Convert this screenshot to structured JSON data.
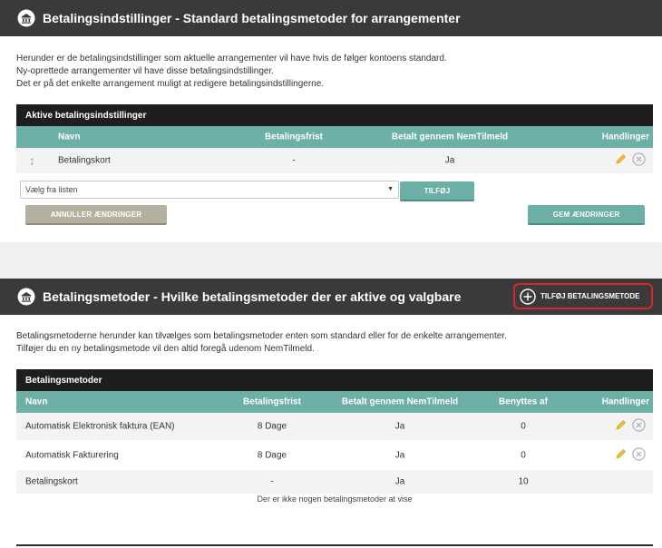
{
  "section1": {
    "title": "Betalingsindstillinger - Standard betalingsmetoder for arrangementer",
    "description": [
      "Herunder er de betalingsindstillinger som aktuelle arrangementer vil have hvis de følger kontoens standard.",
      "Ny-oprettede arrangementer vil have disse betalingsindstillinger.",
      "Det er på det enkelte arrangement muligt at redigere betalingsindstillingerne."
    ],
    "table": {
      "title": "Aktive betalingsindstillinger",
      "columns": [
        "Navn",
        "Betalingsfrist",
        "Betalt gennem NemTilmeld",
        "Handlinger"
      ],
      "rows": [
        {
          "name": "Betalingskort",
          "frist": "-",
          "nemtilmeld": "Ja"
        }
      ]
    },
    "select": {
      "value": "Vælg fra listen"
    },
    "add_button": "TILFØJ",
    "cancel_button": "ANNULLER ÆNDRINGER",
    "save_button": "GEM ÆNDRINGER"
  },
  "section2": {
    "title": "Betalingsmetoder - Hvilke betalingsmetoder der er aktive og valgbare",
    "add_method_button": "TILFØJ BETALINGSMETODE",
    "description": [
      "Betalingsmetoderne herunder kan tilvælges som betalingsmetoder enten som standard eller for de enkelte arrangementer.",
      "Tilføjer du en ny betalingsmetode vil den altid foregå udenom NemTilmeld."
    ],
    "table": {
      "title": "Betalingsmetoder",
      "columns": [
        "Navn",
        "Betalingsfrist",
        "Betalt gennem NemTilmeld",
        "Benyttes af",
        "Handlinger"
      ],
      "rows": [
        {
          "name": "Automatisk Elektronisk faktura (EAN)",
          "frist": "8 Dage",
          "nemtilmeld": "Ja",
          "benyttes": "0"
        },
        {
          "name": "Automatisk Fakturering",
          "frist": "8 Dage",
          "nemtilmeld": "Ja",
          "benyttes": "0"
        },
        {
          "name": "Betalingskort",
          "frist": "-",
          "nemtilmeld": "Ja",
          "benyttes": "10"
        }
      ],
      "empty_message": "Der er ikke nogen betalingsmetoder at vise"
    }
  },
  "colors": {
    "header_bg": "#3a3a3a",
    "teal": "#6bafa6",
    "khaki": "#b5b1a0",
    "highlight_red": "#d8262a"
  },
  "icons": [
    "bank-icon",
    "drag-handle-icon",
    "pencil-icon",
    "remove-circle-icon",
    "plus-circle-icon",
    "caret-down-icon"
  ]
}
